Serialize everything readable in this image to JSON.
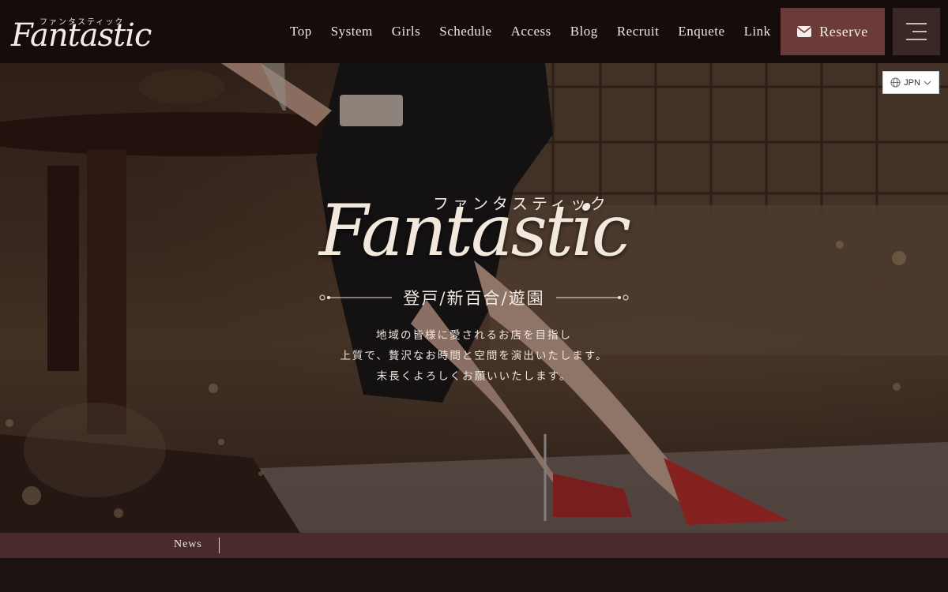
{
  "header": {
    "logo_kana": "ファンタスティック",
    "logo_text": "Fantastic",
    "nav": [
      "Top",
      "System",
      "Girls",
      "Schedule",
      "Access",
      "Blog",
      "Recruit",
      "Enquete",
      "Link"
    ],
    "reserve_label": "Reserve"
  },
  "lang": {
    "label": "JPN"
  },
  "hero": {
    "kana": "ファンタスティック",
    "title": "Fantastic",
    "areas": "登戸/新百合/遊園",
    "lines": [
      "地域の皆様に愛されるお店を目指し",
      "上質で、贅沢なお時間と空間を演出いたします。",
      "末長くよろしくお願いいたします。"
    ]
  },
  "news": {
    "label": "News"
  },
  "colors": {
    "header_bg": "#150c0b",
    "reserve_bg": "#6b3b38",
    "menu_bg": "#3a2826",
    "news_bg": "#4a2b2b"
  },
  "icons": [
    "mail-icon",
    "hamburger-icon",
    "globe-icon",
    "chevron-down-icon"
  ]
}
